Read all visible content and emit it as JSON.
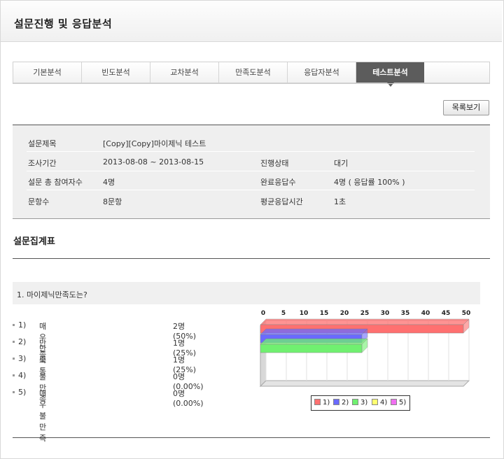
{
  "header": {
    "title": "설문진행 및 응답분석"
  },
  "tabs": [
    {
      "label": "기본분석"
    },
    {
      "label": "빈도분석"
    },
    {
      "label": "교차분석"
    },
    {
      "label": "만족도분석"
    },
    {
      "label": "응답자분석"
    },
    {
      "label": "테스트분석",
      "active": true
    }
  ],
  "list_button": "목록보기",
  "survey_info": {
    "title_label": "설문제목",
    "title_value": "[Copy][Copy]마이제닉 테스트",
    "period_label": "조사기간",
    "period_value": "2013-08-08 ~ 2013-08-15",
    "status_label": "진행상태",
    "status_value": "대기",
    "participants_label": "설문 총 참여자수",
    "participants_value": "4명",
    "completed_label": "완료응답수",
    "completed_value": "4명 ( 응답률 100% )",
    "questions_label": "문항수",
    "questions_value": "8문항",
    "avg_time_label": "평균응답시간",
    "avg_time_value": "1초"
  },
  "section_title": "설문집계표",
  "question": {
    "text": "1. 마이제닉만족도는?",
    "options": [
      {
        "num": "1)",
        "label": "매우만족",
        "count": "2명 (50%)"
      },
      {
        "num": "2)",
        "label": "만족",
        "count": "1명 (25%)"
      },
      {
        "num": "3)",
        "label": "보통",
        "count": "1명 (25%)"
      },
      {
        "num": "4)",
        "label": "불만족",
        "count": "0명 (0.00%)"
      },
      {
        "num": "5)",
        "label": "매우불만족",
        "count": "0명 (0.00%)"
      }
    ]
  },
  "chart_data": {
    "type": "bar",
    "orientation": "horizontal",
    "3d": true,
    "categories": [
      "1)",
      "2)",
      "3)",
      "4)",
      "5)"
    ],
    "values": [
      50,
      25,
      25,
      0,
      0
    ],
    "colors": [
      "#ff7070",
      "#6a6aff",
      "#70f070",
      "#ffff70",
      "#f070f0"
    ],
    "xlim": [
      0,
      50
    ],
    "xticks": [
      "0",
      "5",
      "10",
      "15",
      "20",
      "25",
      "30",
      "35",
      "40",
      "45",
      "50"
    ],
    "grid": true,
    "legend_position": "bottom",
    "legend": [
      "1)",
      "2)",
      "3)",
      "4)",
      "5)"
    ]
  }
}
